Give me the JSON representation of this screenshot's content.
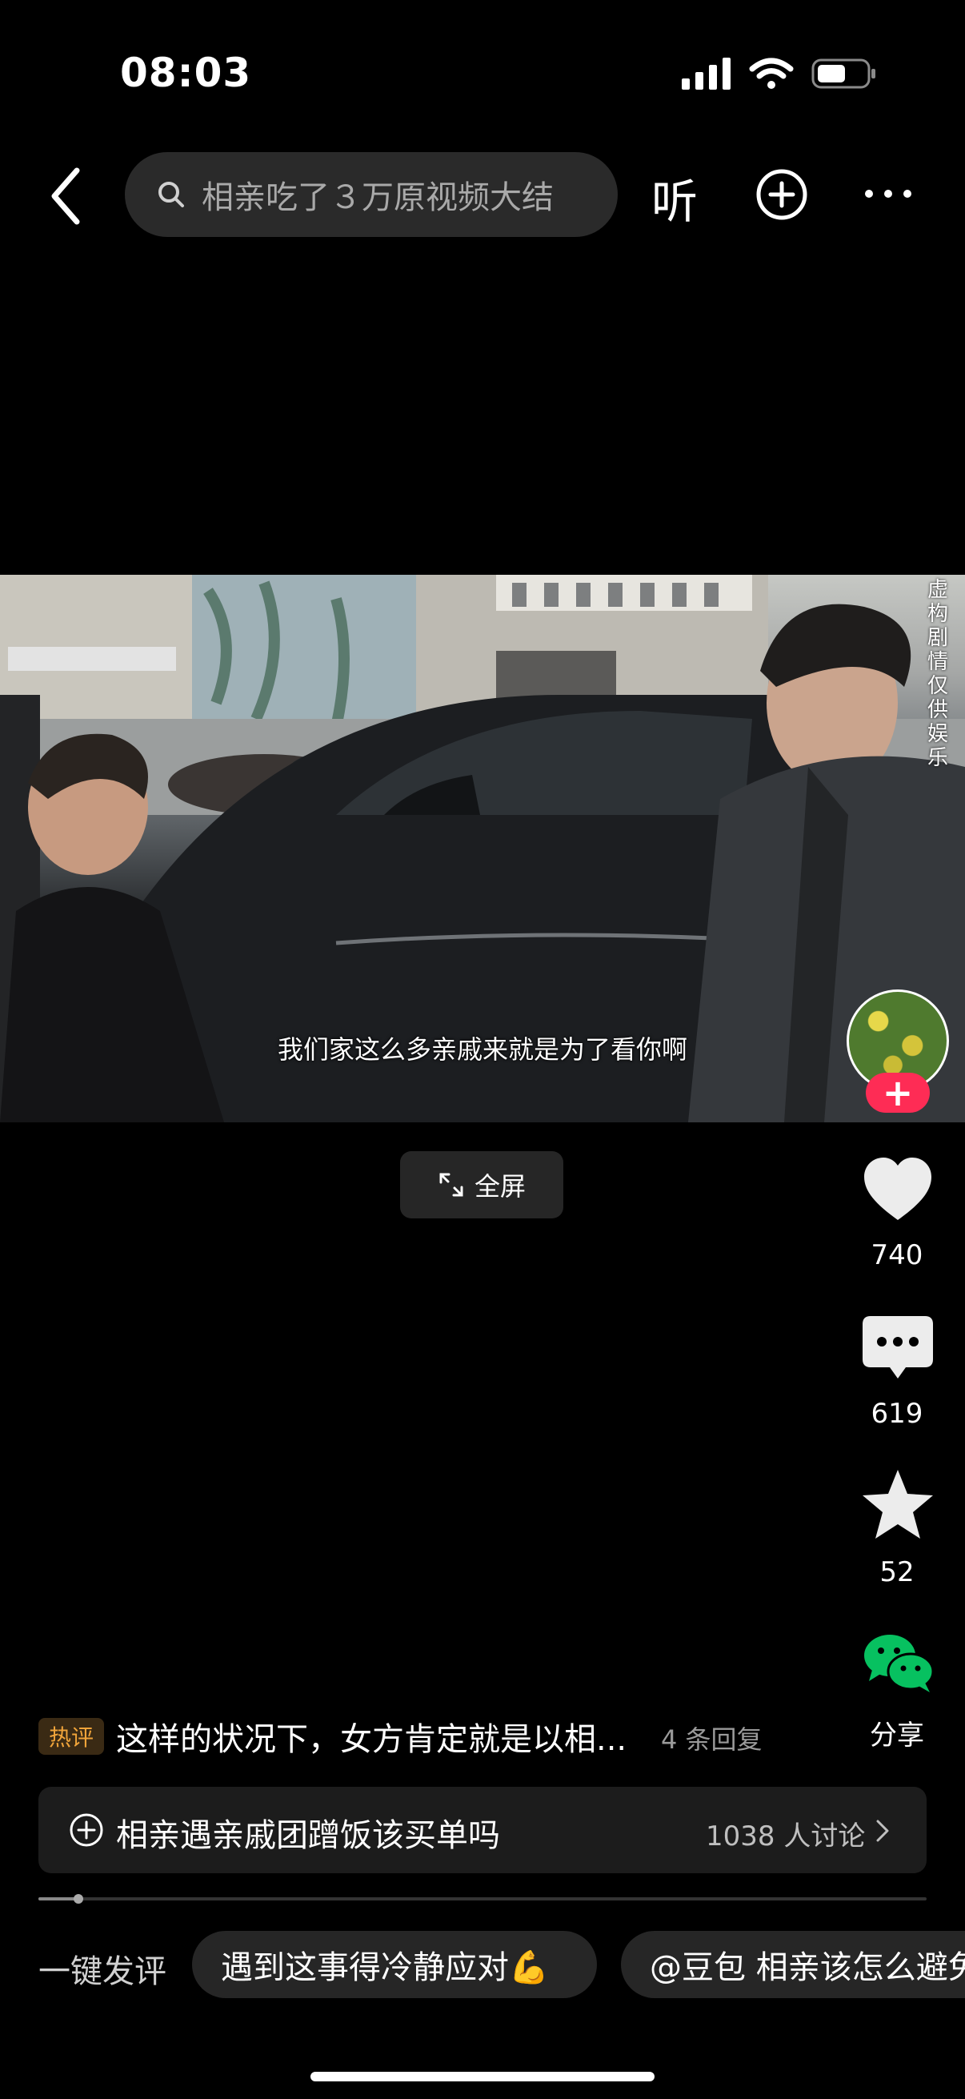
{
  "status_bar": {
    "time": "08:03"
  },
  "search": {
    "query": "相亲吃了３万原视频大结"
  },
  "top_bar": {
    "listen_label": "听"
  },
  "video": {
    "subtitle": "我们家这么多亲戚来就是为了看你啊",
    "watermark": "虚构剧情仅供娱乐"
  },
  "fullscreen": {
    "label": "全屏"
  },
  "actions": {
    "likes": "740",
    "comments": "619",
    "favorites": "52",
    "share_label": "分享",
    "follow_label": "+"
  },
  "hot_comment": {
    "badge": "热评",
    "text": "这样的状况下，女方肯定就是以相...",
    "replies": "4 条回复"
  },
  "topic": {
    "title": "相亲遇亲戚团蹭饭该买单吗",
    "count": "1038 人讨论"
  },
  "quick_comment": {
    "label": "一键发评",
    "chips": [
      "遇到这事得冷静应对💪",
      "@豆包 相亲该怎么避免"
    ]
  },
  "colors": {
    "accent": "#fe2c55",
    "wechat": "#07c160",
    "hot_badge": "#f0a43a"
  }
}
